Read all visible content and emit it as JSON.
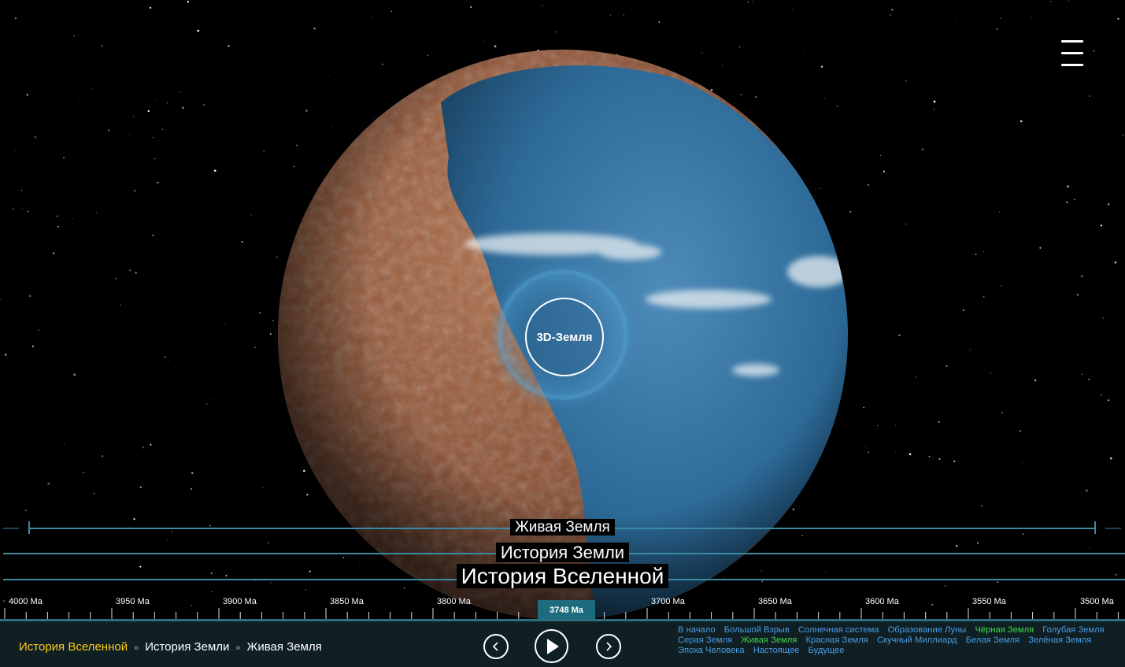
{
  "menu": {
    "icon": "hamburger-menu-icon"
  },
  "center_button": {
    "label": "3D-Земля"
  },
  "timeline": {
    "levels": [
      {
        "label": "Живая Земля"
      },
      {
        "label": "История Земли"
      },
      {
        "label": "История Вселенной"
      }
    ],
    "ticks": [
      "4000 Ma",
      "3950 Ma",
      "3900 Ma",
      "3850 Ma",
      "3800 Ma",
      "3700 Ma",
      "3650 Ma",
      "3600 Ma",
      "3550 Ma",
      "3500 Ma"
    ],
    "current": "3748 Ma"
  },
  "breadcrumb": {
    "items": [
      "История Вселенной",
      "История Земли",
      "Живая Земля"
    ],
    "separator": "»",
    "active_color": "#ffcc1a"
  },
  "player": {
    "prev_icon": "chevron-left-icon",
    "play_icon": "play-icon",
    "next_icon": "chevron-right-icon"
  },
  "chapters": [
    {
      "label": "В начало",
      "active": false
    },
    {
      "label": "Большой Взрыв",
      "active": false
    },
    {
      "label": "Солнечная система",
      "active": false
    },
    {
      "label": "Образование Луны",
      "active": false
    },
    {
      "label": "Чёрная Земля",
      "active": false
    },
    {
      "label": "Голубая Земля",
      "active": false
    },
    {
      "label": "Серая Земля",
      "active": false
    },
    {
      "label": "Живая Земля",
      "active": true
    },
    {
      "label": "Красная Земля",
      "active": false
    },
    {
      "label": "Скучный Миллиард",
      "active": false
    },
    {
      "label": "Белая Земля",
      "active": false
    },
    {
      "label": "Зелёная Земля",
      "active": false
    },
    {
      "label": "Эпоха Человека",
      "active": false
    },
    {
      "label": "Настоящее",
      "active": false
    },
    {
      "label": "Будущее",
      "active": false
    }
  ],
  "colors": {
    "link": "#4b9ce2",
    "link_active": "#3ddc4a",
    "timeline": "#3b8aa3",
    "bar": "#0f1f24"
  }
}
